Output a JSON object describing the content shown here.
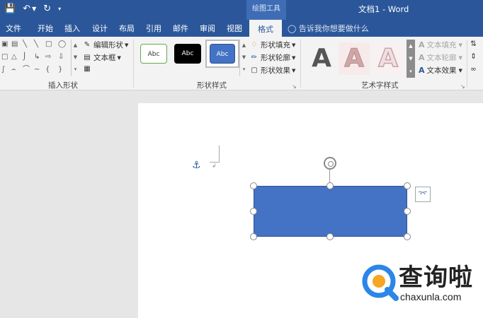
{
  "window": {
    "title": "文档1 - Word",
    "context_tool_label": "绘图工具"
  },
  "quick_access": {
    "save_icon": "save-icon",
    "undo_icon": "undo-icon",
    "undo_dropdown_icon": "chevron-down-icon",
    "redo_icon": "repeat-icon",
    "customize_icon": "customize-qat-icon"
  },
  "tabs": [
    {
      "label": "文件"
    },
    {
      "label": "开始"
    },
    {
      "label": "插入"
    },
    {
      "label": "设计"
    },
    {
      "label": "布局"
    },
    {
      "label": "引用"
    },
    {
      "label": "邮件"
    },
    {
      "label": "审阅"
    },
    {
      "label": "视图"
    },
    {
      "label": "格式",
      "active": true
    }
  ],
  "tell_me": {
    "placeholder": "告诉我你想要做什么"
  },
  "ribbon": {
    "insert_shapes": {
      "label": "插入形状",
      "edit_shape": "编辑形状",
      "text_box": "文本框"
    },
    "shape_styles": {
      "label": "形状样式",
      "thumb_text": "Abc",
      "fill": "形状填充",
      "outline": "形状轮廓",
      "effects": "形状效果"
    },
    "wordart_styles": {
      "label": "艺术字样式",
      "thumb_letter": "A",
      "text_fill": "文本填充",
      "text_outline": "文本轮廓",
      "text_effects": "文本效果"
    }
  },
  "colors": {
    "brand": "#2b579a",
    "shape_fill": "#4472c4",
    "shape_outline": "#2f528f"
  },
  "watermark": {
    "logo_text": "查询啦",
    "url": "chaxunla.com"
  }
}
